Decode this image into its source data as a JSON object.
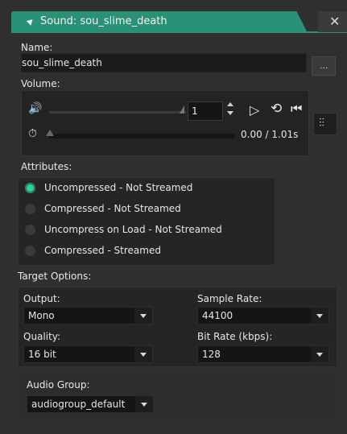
{
  "window": {
    "title": "Sound: sou_slime_death",
    "close": "✕"
  },
  "name": {
    "label": "Name:",
    "value": "sou_slime_death",
    "browse_label": "..."
  },
  "volume": {
    "label": "Volume:",
    "value": "1",
    "speaker_icon": "speaker-icon",
    "time": "0.00 / 1.01s"
  },
  "attributes": {
    "label": "Attributes:",
    "options": [
      {
        "label": "Uncompressed - Not Streamed",
        "selected": true
      },
      {
        "label": "Compressed - Not Streamed",
        "selected": false
      },
      {
        "label": "Uncompress on Load - Not Streamed",
        "selected": false
      },
      {
        "label": "Compressed - Streamed",
        "selected": false
      }
    ]
  },
  "target": {
    "label": "Target Options:",
    "output_label": "Output:",
    "output_value": "Mono",
    "sample_rate_label": "Sample Rate:",
    "sample_rate_value": "44100",
    "quality_label": "Quality:",
    "quality_value": "16 bit",
    "bitrate_label": "Bit Rate (kbps):",
    "bitrate_value": "128"
  },
  "audio_group": {
    "label": "Audio Group:",
    "value": "audiogroup_default"
  },
  "colors": {
    "accent": "#2a9076",
    "radio_on": "#2bd09a",
    "bg": "#2f2f2f"
  }
}
